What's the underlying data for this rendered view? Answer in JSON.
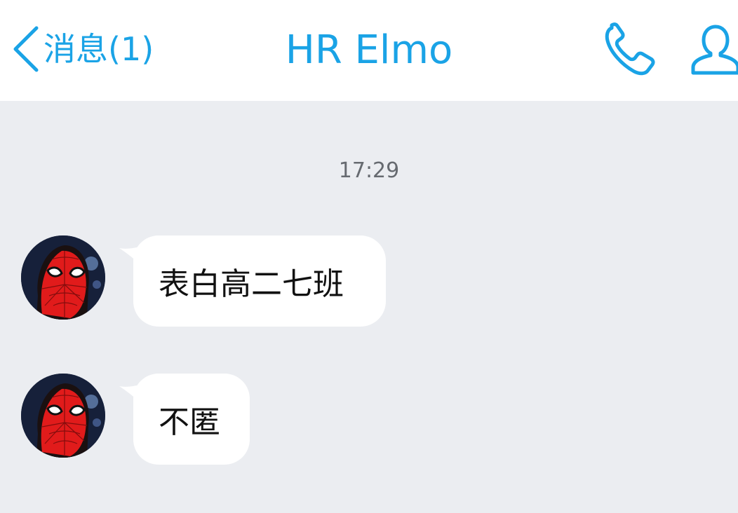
{
  "header": {
    "back_label": "消息(1)",
    "title": "HR Elmo",
    "accent_color": "#1aa3e6",
    "icons": [
      "chevron-left-icon",
      "phone-icon",
      "user-profile-icon"
    ]
  },
  "chat": {
    "timestamp": "17:29",
    "background_color": "#ebedf1",
    "messages": [
      {
        "sender_avatar": "spiderman-avatar",
        "text": "表白高二七班"
      },
      {
        "sender_avatar": "spiderman-avatar",
        "text": "不匿"
      }
    ]
  }
}
